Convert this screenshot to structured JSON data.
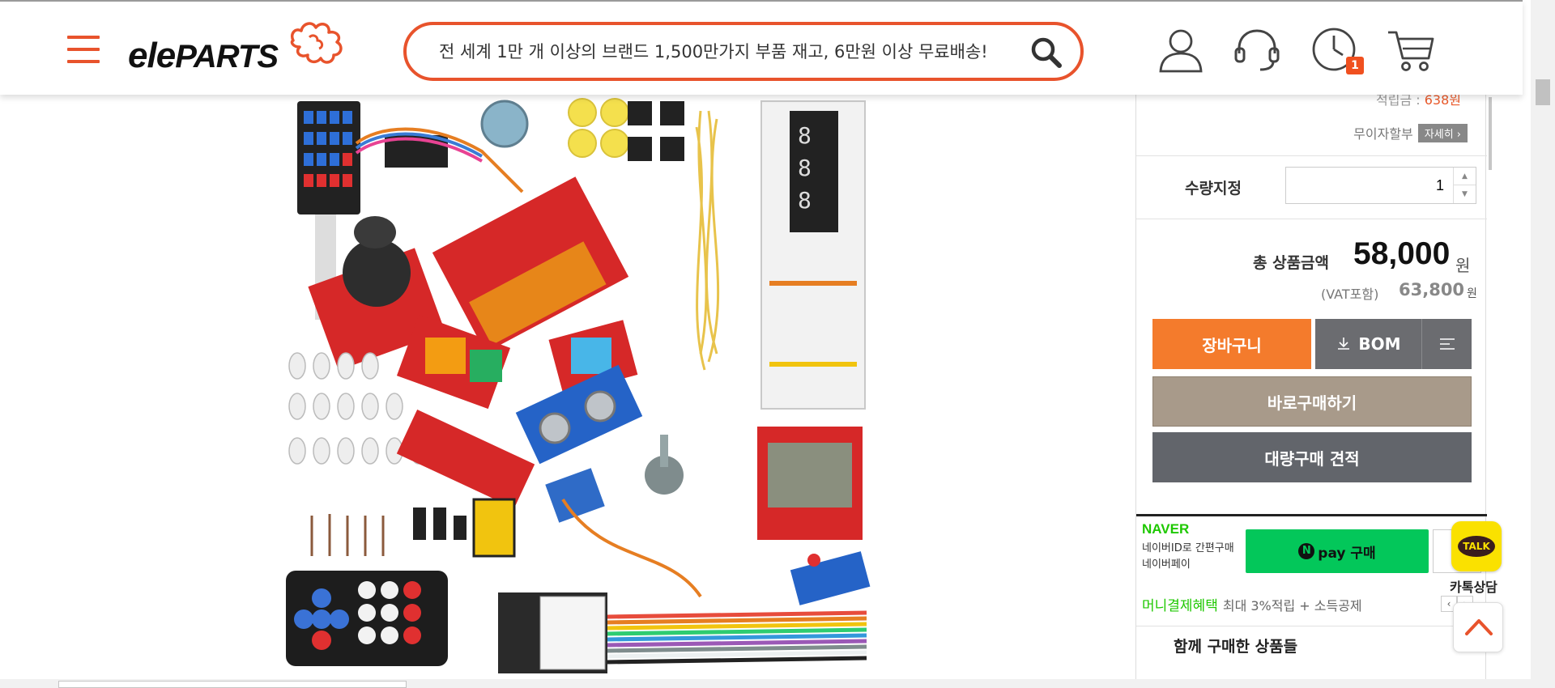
{
  "header": {
    "logo_text_a": "e",
    "logo_text_b": "l",
    "logo_text_c": "e",
    "logo_text_d": "PARTS",
    "search_placeholder": "전 세계 1만 개 이상의 브랜드 1,500만가지 부품 재고, 6만원 이상 무료배송!",
    "recent_badge": "1"
  },
  "panel": {
    "mileage_label": "적립금 : ",
    "mileage_value": "638원",
    "installment_label": "무이자할부",
    "detail_button": "자세히 ›",
    "qty_label": "수량지정",
    "qty_value": "1",
    "stepper_up": "▲",
    "stepper_down": "▼",
    "total_label": "총 상품금액",
    "total_value": "58,000",
    "total_unit": "원",
    "vat_label": "(VAT포함)",
    "vat_value": "63,800",
    "vat_unit": "원",
    "cart_button": "장바구니",
    "bom_button": "BOM",
    "buy_now_button": "바로구매하기",
    "bulk_quote_button": "대량구매 견적"
  },
  "naver": {
    "logo": "NAVER",
    "desc_line1": "네이버ID로 간편구매",
    "desc_line2": "네이버페이",
    "npay_n": "N",
    "npay_label": "pay 구매",
    "money_benefit": "머니결제혜택",
    "money_detail": "최대 3%적립 + 소득공제",
    "prev": "‹",
    "next": "›",
    "bought_together": "함께 구매한 상품들"
  },
  "floating": {
    "talk_bubble": "TALK",
    "talk_label": "카톡상담"
  },
  "colors": {
    "brand_orange": "#e8532c",
    "cart_orange": "#f47b2c",
    "buy_now_taupe": "#a89a8a",
    "bulk_gray": "#62656b",
    "npay_green": "#03c75a",
    "kakao_yellow": "#fae100"
  },
  "icons": [
    "menu-icon",
    "search-icon",
    "user-icon",
    "headset-icon",
    "clock-icon",
    "cart-icon",
    "download-icon",
    "list-icon",
    "scroll-top-icon"
  ]
}
